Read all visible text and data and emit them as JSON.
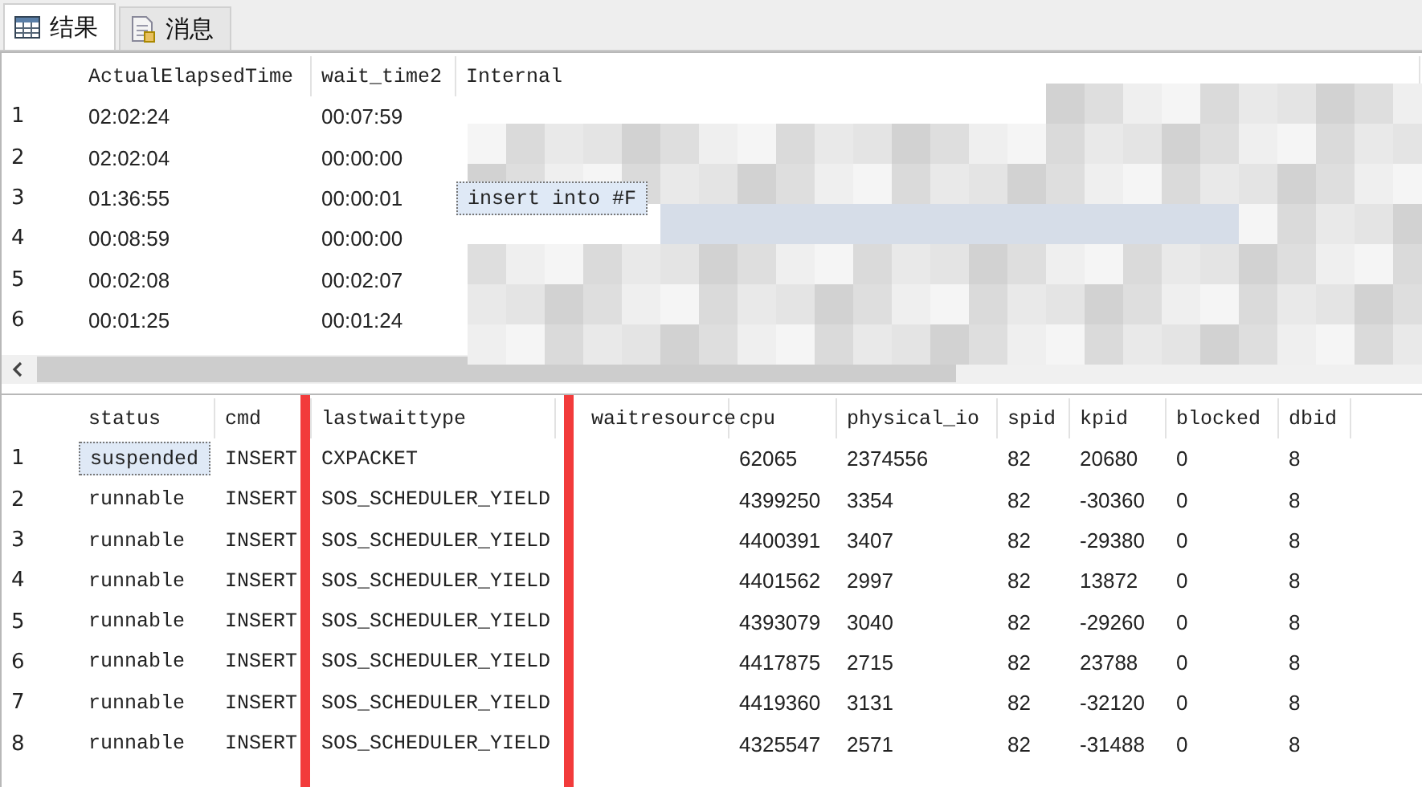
{
  "tabs": [
    {
      "label": "结果",
      "selected": true
    },
    {
      "label": "消息",
      "selected": false
    }
  ],
  "grids": [
    {
      "redacted": true,
      "scrollbar": true,
      "columns": [
        {
          "label": "ActualElapsedTime",
          "current": false,
          "highlighted": false
        },
        {
          "label": "wait_time2",
          "current": false,
          "highlighted": false
        },
        {
          "label": "Internal",
          "current": true,
          "highlighted": false
        }
      ],
      "rows": [
        {
          "number": "1",
          "selected": false,
          "cells": [
            "02:02:24",
            "00:07:59"
          ]
        },
        {
          "number": "2",
          "selected": false,
          "cells": [
            "02:02:04",
            "00:00:00"
          ]
        },
        {
          "number": "3",
          "selected": true,
          "cells": [
            "01:36:55",
            "00:00:01",
            "insert into #F"
          ]
        },
        {
          "number": "4",
          "selected": false,
          "cells": [
            "00:08:59",
            "00:00:00"
          ]
        },
        {
          "number": "5",
          "selected": false,
          "cells": [
            "00:02:08",
            "00:02:07"
          ]
        },
        {
          "number": "6",
          "selected": false,
          "cells": [
            "00:01:25",
            "00:01:24"
          ]
        }
      ]
    },
    {
      "redacted": false,
      "scrollbar": false,
      "columns": [
        {
          "label": "status",
          "current": true,
          "highlighted": false
        },
        {
          "label": "cmd",
          "current": false,
          "highlighted": false
        },
        {
          "label": "lastwaittype",
          "current": false,
          "highlighted": true
        },
        {
          "label": "waitresource",
          "current": false,
          "highlighted": false
        },
        {
          "label": "cpu",
          "current": false,
          "highlighted": false
        },
        {
          "label": "physical_io",
          "current": false,
          "highlighted": false
        },
        {
          "label": "spid",
          "current": false,
          "highlighted": false
        },
        {
          "label": "kpid",
          "current": false,
          "highlighted": false
        },
        {
          "label": "blocked",
          "current": false,
          "highlighted": false
        },
        {
          "label": "dbid",
          "current": false,
          "highlighted": false
        }
      ],
      "rows": [
        {
          "number": "1",
          "selected": true,
          "cells": [
            "suspended",
            "INSERT",
            "CXPACKET",
            "",
            "62065",
            "2374556",
            "82",
            "20680",
            "0",
            "8"
          ]
        },
        {
          "number": "2",
          "selected": false,
          "cells": [
            "runnable",
            "INSERT",
            "SOS_SCHEDULER_YIELD",
            "",
            "4399250",
            "3354",
            "82",
            "-30360",
            "0",
            "8"
          ]
        },
        {
          "number": "3",
          "selected": false,
          "cells": [
            "runnable",
            "INSERT",
            "SOS_SCHEDULER_YIELD",
            "",
            "4400391",
            "3407",
            "82",
            "-29380",
            "0",
            "8"
          ]
        },
        {
          "number": "4",
          "selected": false,
          "cells": [
            "runnable",
            "INSERT",
            "SOS_SCHEDULER_YIELD",
            "",
            "4401562",
            "2997",
            "82",
            "13872",
            "0",
            "8"
          ]
        },
        {
          "number": "5",
          "selected": false,
          "cells": [
            "runnable",
            "INSERT",
            "SOS_SCHEDULER_YIELD",
            "",
            "4393079",
            "3040",
            "82",
            "-29260",
            "0",
            "8"
          ]
        },
        {
          "number": "6",
          "selected": false,
          "cells": [
            "runnable",
            "INSERT",
            "SOS_SCHEDULER_YIELD",
            "",
            "4417875",
            "2715",
            "82",
            "23788",
            "0",
            "8"
          ]
        },
        {
          "number": "7",
          "selected": false,
          "cells": [
            "runnable",
            "INSERT",
            "SOS_SCHEDULER_YIELD",
            "",
            "4419360",
            "3131",
            "82",
            "-32120",
            "0",
            "8"
          ]
        },
        {
          "number": "8",
          "selected": false,
          "cells": [
            "runnable",
            "INSERT",
            "SOS_SCHEDULER_YIELD",
            "",
            "4325547",
            "2571",
            "82",
            "-31488",
            "0",
            "8"
          ]
        }
      ]
    }
  ]
}
